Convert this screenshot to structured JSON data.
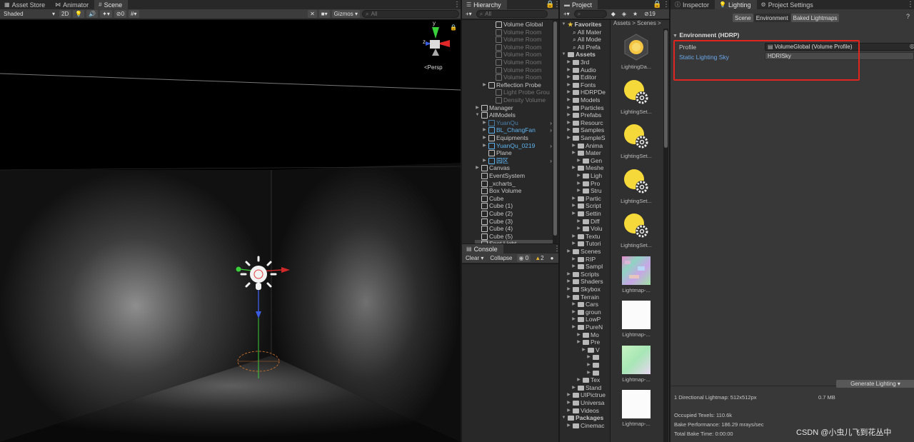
{
  "tabs_left": [
    {
      "label": "Asset Store",
      "icon": "asset-store-icon"
    },
    {
      "label": "Animator",
      "icon": "animator-icon"
    },
    {
      "label": "Scene",
      "icon": "scene-icon"
    }
  ],
  "tabs_hierarchy": {
    "label": "Hierarchy"
  },
  "tabs_project": {
    "label": "Project"
  },
  "tabs_right": [
    {
      "label": "Inspector"
    },
    {
      "label": "Lighting"
    },
    {
      "label": "Project Settings"
    }
  ],
  "scene_toolbar": {
    "shading": "Shaded",
    "mode_2d": "2D",
    "hidden_count": "0",
    "gizmos": "Gizmos",
    "search_placeholder": "All"
  },
  "scene_view": {
    "projection": "Persp"
  },
  "hierarchy": {
    "search_placeholder": "All",
    "items": [
      {
        "label": "Volume Global",
        "style": "normal"
      },
      {
        "label": "Volume Room",
        "style": "dim"
      },
      {
        "label": "Volume Room",
        "style": "dim"
      },
      {
        "label": "Volume Room",
        "style": "dim"
      },
      {
        "label": "Volume Room",
        "style": "dim"
      },
      {
        "label": "Volume Room",
        "style": "dim"
      },
      {
        "label": "Volume Room",
        "style": "dim"
      },
      {
        "label": "Volume Room",
        "style": "dim"
      },
      {
        "label": "Reflection Probe",
        "style": "normal"
      },
      {
        "label": "Light Probe Grou",
        "style": "dim"
      },
      {
        "label": "Density Volume",
        "style": "dim"
      },
      {
        "label": "Manager",
        "style": "normal"
      },
      {
        "label": "AllModels",
        "style": "normal"
      },
      {
        "label": "YuanQu",
        "style": "dimblue"
      },
      {
        "label": "BL_ChangFan",
        "style": "blue"
      },
      {
        "label": "Equipments",
        "style": "normal"
      },
      {
        "label": "YuanQu_0219",
        "style": "blue"
      },
      {
        "label": "Plane",
        "style": "normal"
      },
      {
        "label": "园区",
        "style": "blue"
      },
      {
        "label": "Canvas",
        "style": "normal"
      },
      {
        "label": "EventSystem",
        "style": "normal"
      },
      {
        "label": "_xcharts_",
        "style": "normal"
      },
      {
        "label": "Box Volume",
        "style": "normal"
      },
      {
        "label": "Cube",
        "style": "normal"
      },
      {
        "label": "Cube (1)",
        "style": "normal"
      },
      {
        "label": "Cube (2)",
        "style": "normal"
      },
      {
        "label": "Cube (3)",
        "style": "normal"
      },
      {
        "label": "Cube (4)",
        "style": "normal"
      },
      {
        "label": "Cube (5)",
        "style": "normal"
      },
      {
        "label": "Spot Light",
        "style": "sel"
      }
    ]
  },
  "console": {
    "tab": "Console",
    "clear": "Clear",
    "collapse": "Collapse",
    "log_count": "0",
    "warn_count": "2"
  },
  "project": {
    "layer_count": "19",
    "breadcrumb": [
      "Assets",
      "Scenes"
    ],
    "tree": [
      {
        "label": "Favorites",
        "kind": "fav"
      },
      {
        "label": "All Mater",
        "kind": "search"
      },
      {
        "label": "All Mode",
        "kind": "search"
      },
      {
        "label": "All Prefa",
        "kind": "search"
      },
      {
        "label": "Assets",
        "kind": "root"
      },
      {
        "label": "3rd",
        "kind": "folder"
      },
      {
        "label": "Audio",
        "kind": "folder"
      },
      {
        "label": "Editor",
        "kind": "folder"
      },
      {
        "label": "Fonts",
        "kind": "folder"
      },
      {
        "label": "HDRPDe",
        "kind": "folder"
      },
      {
        "label": "Models",
        "kind": "folder"
      },
      {
        "label": "Particles",
        "kind": "folder"
      },
      {
        "label": "Prefabs",
        "kind": "folder"
      },
      {
        "label": "Resourc",
        "kind": "folder"
      },
      {
        "label": "Samples",
        "kind": "folder"
      },
      {
        "label": "SampleS",
        "kind": "folder"
      },
      {
        "label": "Anima",
        "kind": "folder"
      },
      {
        "label": "Mater",
        "kind": "folder"
      },
      {
        "label": "Gen",
        "kind": "folder"
      },
      {
        "label": "Meshe",
        "kind": "folder"
      },
      {
        "label": "Ligh",
        "kind": "folder"
      },
      {
        "label": "Pro",
        "kind": "folder"
      },
      {
        "label": "Stru",
        "kind": "folder"
      },
      {
        "label": "Partic",
        "kind": "folder"
      },
      {
        "label": "Script",
        "kind": "folder"
      },
      {
        "label": "Settin",
        "kind": "folder"
      },
      {
        "label": "Diff",
        "kind": "folder"
      },
      {
        "label": "Volu",
        "kind": "folder"
      },
      {
        "label": "Textu",
        "kind": "folder"
      },
      {
        "label": "Tutori",
        "kind": "folder"
      },
      {
        "label": "Scenes",
        "kind": "folder"
      },
      {
        "label": "RIP",
        "kind": "folder"
      },
      {
        "label": "Sampl",
        "kind": "folder"
      },
      {
        "label": "Scripts",
        "kind": "folder"
      },
      {
        "label": "Shaders",
        "kind": "folder"
      },
      {
        "label": "Skybox",
        "kind": "folder"
      },
      {
        "label": "Terrain",
        "kind": "folder"
      },
      {
        "label": "Cars",
        "kind": "folder"
      },
      {
        "label": "groun",
        "kind": "folder"
      },
      {
        "label": "LowP",
        "kind": "folder"
      },
      {
        "label": "PureN",
        "kind": "folder"
      },
      {
        "label": "Mo",
        "kind": "folder"
      },
      {
        "label": "Pre",
        "kind": "folder"
      },
      {
        "label": "V",
        "kind": "folder"
      },
      {
        "label": "",
        "kind": "folder"
      },
      {
        "label": "",
        "kind": "folder"
      },
      {
        "label": "",
        "kind": "folder"
      },
      {
        "label": "Tex",
        "kind": "folder"
      },
      {
        "label": "Stand",
        "kind": "folder"
      },
      {
        "label": "UIPictrue",
        "kind": "folder"
      },
      {
        "label": "Universa",
        "kind": "folder"
      },
      {
        "label": "Videos",
        "kind": "folder"
      },
      {
        "label": "Packages",
        "kind": "root"
      },
      {
        "label": "Cinemac",
        "kind": "folder"
      }
    ],
    "grid": [
      {
        "label": "LightingDa...",
        "kind": "lighting-data"
      },
      {
        "label": "LightingSet...",
        "kind": "lighting-settings"
      },
      {
        "label": "LightingSet...",
        "kind": "lighting-settings"
      },
      {
        "label": "LightingSet...",
        "kind": "lighting-settings"
      },
      {
        "label": "LightingSet...",
        "kind": "lighting-settings"
      },
      {
        "label": "Lightmap-...",
        "kind": "lightmap-noise"
      },
      {
        "label": "Lightmap-...",
        "kind": "lightmap-white"
      },
      {
        "label": "Lightmap-...",
        "kind": "lightmap-green"
      },
      {
        "label": "Lightmap-...",
        "kind": "lightmap-white"
      }
    ]
  },
  "lighting": {
    "subtabs": [
      "Scene",
      "Environment",
      "Baked Lightmaps"
    ],
    "section": "Environment (HDRP)",
    "profile_label": "Profile",
    "profile_value": "VolumeGlobal (Volume Profile)",
    "sky_label": "Static Lighting Sky",
    "sky_value": "HDRISky",
    "generate_button": "Generate Lighting",
    "stats": {
      "lightmap": "1 Directional Lightmap: 512x512px",
      "size": "0.7 MB",
      "texels": "Occupied Texels: 110.6k",
      "performance": "Bake Performance: 186.29 mrays/sec",
      "bake_time": "Total Bake Time: 0:00:00"
    },
    "highlight_color": "#e0251e"
  },
  "watermark": "CSDN @小虫儿飞到花丛中"
}
